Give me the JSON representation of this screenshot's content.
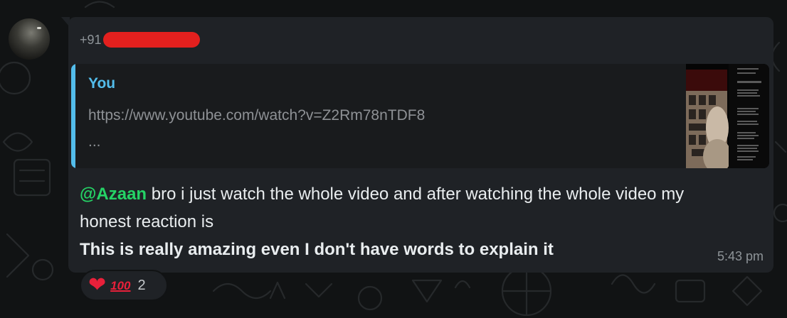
{
  "sender": {
    "phone_prefix": "+91"
  },
  "quote": {
    "author": "You",
    "link": "https://www.youtube.com/watch?v=Z2Rm78nTDF8",
    "ellipsis": "..."
  },
  "message": {
    "mention": "@Azaan",
    "text_line1": " bro i just watch the whole video and after watching the whole video my honest reaction is",
    "text_line2": "This is really amazing even I don't have words to explain it",
    "time": "5:43 pm"
  },
  "reactions": {
    "heart": "❤",
    "hundred": "100",
    "count": "2"
  },
  "colors": {
    "background": "#111314",
    "bubble": "#1f2226",
    "quote_accent": "#53bdeb",
    "mention": "#25d366",
    "redaction": "#e3201e"
  },
  "icons": {
    "heart": "heart-emoji",
    "hundred": "hundred-points-emoji"
  }
}
